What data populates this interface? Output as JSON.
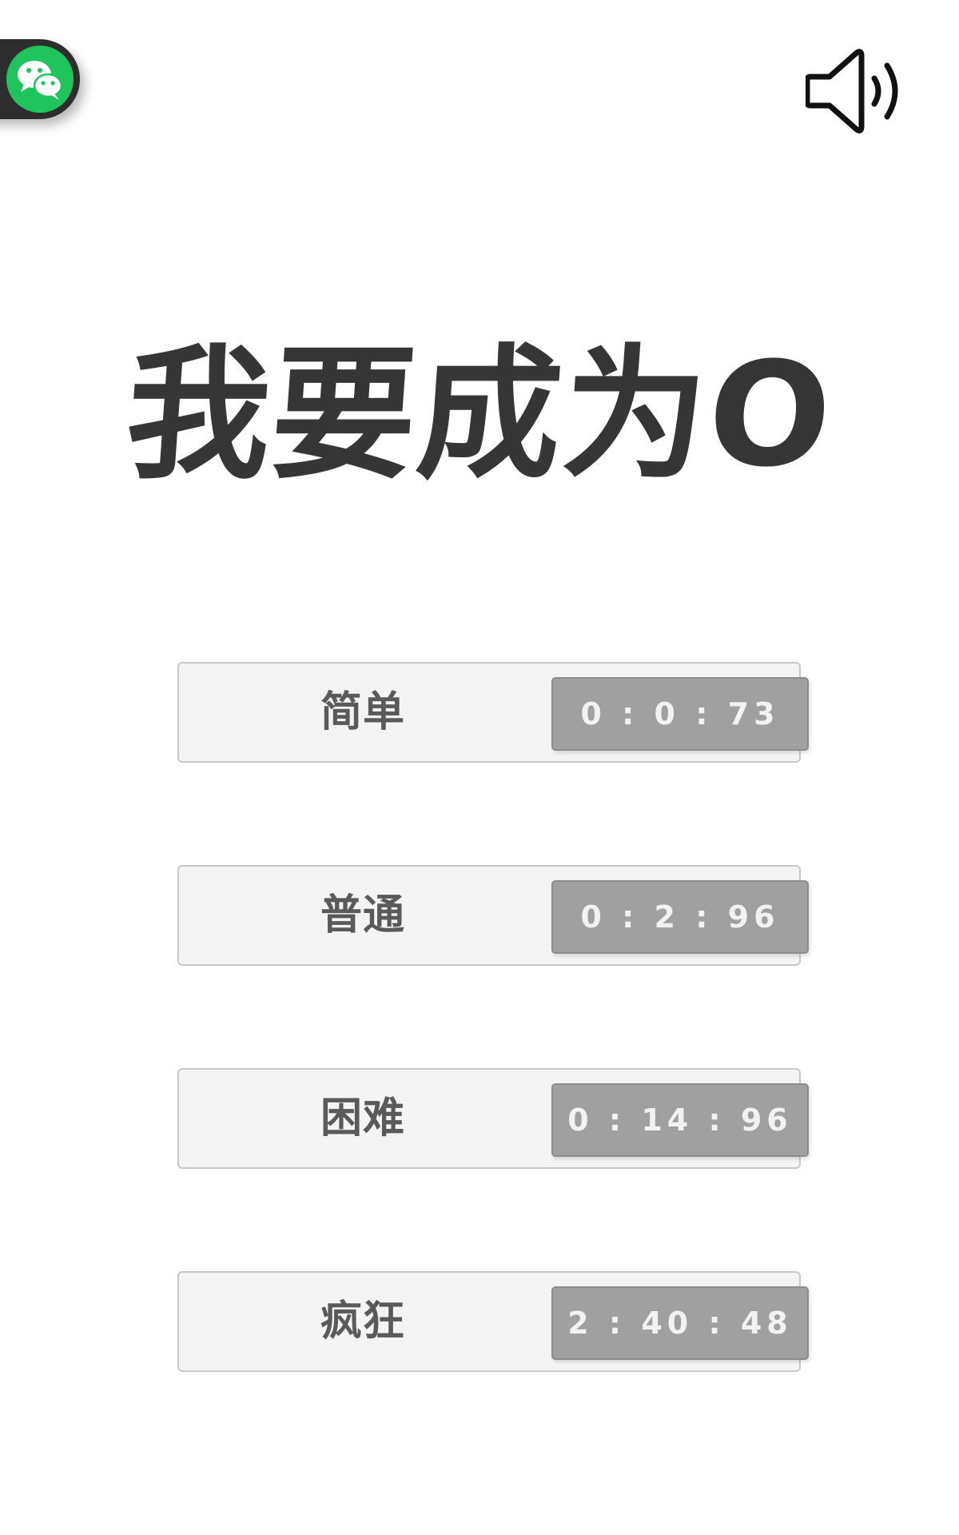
{
  "title": "我要成为O",
  "icons": {
    "share": "wechat-icon",
    "sound": "speaker-icon"
  },
  "colors": {
    "wechat_green": "#1fc45d",
    "title_color": "#363636",
    "row_bg": "#f4f4f4",
    "time_box_bg": "#a0a0a0"
  },
  "levels": [
    {
      "label": "简单",
      "best_time": "0 : 0 : 73"
    },
    {
      "label": "普通",
      "best_time": "0 : 2 : 96"
    },
    {
      "label": "困难",
      "best_time": "0 : 14 : 96"
    },
    {
      "label": "疯狂",
      "best_time": "2 : 40 : 48"
    }
  ]
}
